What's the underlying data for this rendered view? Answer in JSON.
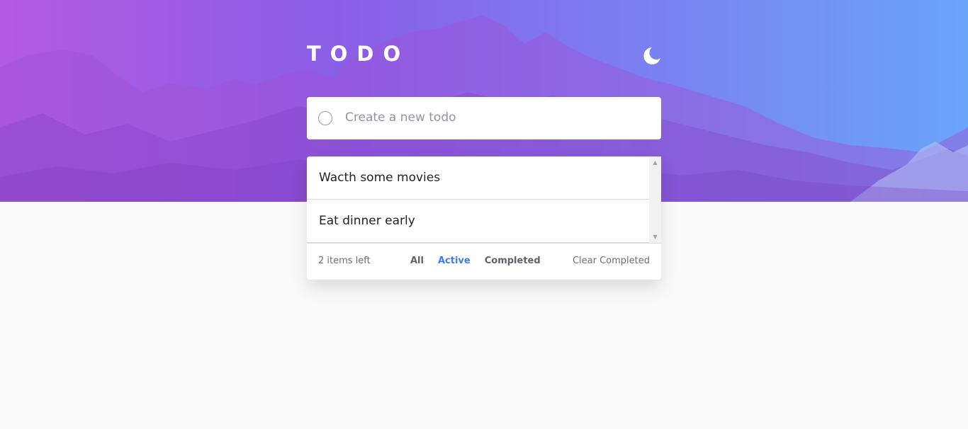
{
  "header": {
    "title": "TODO",
    "theme_toggle_icon": "moon-icon"
  },
  "new_todo": {
    "placeholder": "Create a new todo",
    "value": ""
  },
  "todos": [
    {
      "text": "Wacth some movies"
    },
    {
      "text": "Eat dinner early"
    }
  ],
  "footer": {
    "items_left": "2 items left",
    "filters": [
      {
        "label": "All"
      },
      {
        "label": "Active"
      },
      {
        "label": "Completed"
      }
    ],
    "active_filter": "Active",
    "clear_label": "Clear Completed"
  },
  "colors": {
    "accent": "#3a7bfd",
    "hero_start": "#b35ae0",
    "hero_end": "#6aa4f7",
    "background": "#fafafa"
  }
}
